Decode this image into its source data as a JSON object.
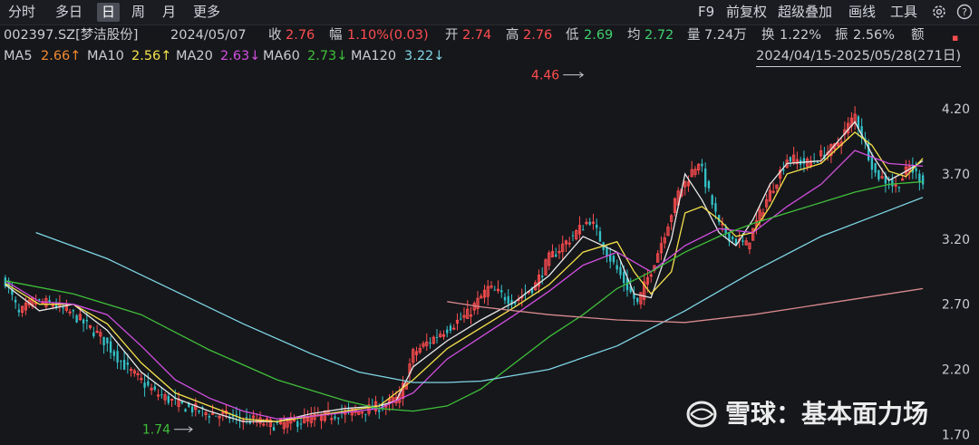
{
  "toolbar": {
    "tabs": [
      "分时",
      "多日",
      "日",
      "周",
      "月",
      "更多"
    ],
    "active_tab": "日",
    "right": [
      "F9",
      "前复权",
      "超级叠加",
      "画线",
      "工具"
    ],
    "icons": [
      "settings-icon",
      "help-icon"
    ]
  },
  "info": {
    "code": "002397.SZ[梦洁股份]",
    "date": "2024/05/07",
    "close_label": "收",
    "close": "2.76",
    "change_label": "幅",
    "change": "1.10%(0.03)",
    "open_label": "开",
    "open": "2.74",
    "high_label": "高",
    "high": "2.76",
    "low_label": "低",
    "low": "2.69",
    "avg_label": "均",
    "avg": "2.72",
    "vol_label": "量",
    "vol": "7.24万",
    "turnover_label": "换",
    "turnover": "1.22%",
    "amp_label": "振",
    "amp": "2.56%",
    "amount_label": "额"
  },
  "ma": {
    "ma5_label": "MA5",
    "ma5": "2.66↑",
    "ma10_label": "MA10",
    "ma10": "2.56↑",
    "ma20_label": "MA20",
    "ma20": "2.63↓",
    "ma60_label": "MA60",
    "ma60": "2.73↓",
    "ma120_label": "MA120",
    "ma120": "3.22↓",
    "range": "2024/04/15-2025/05/28(271日)"
  },
  "colors": {
    "up": "#ff4d4f",
    "down": "#33c3c9",
    "ma5": "#e8e8e8",
    "ma10": "#f5e14b",
    "ma20": "#d14fe0",
    "ma60": "#3fbf3a",
    "ma120": "#7fd6e6",
    "ma250": "#d88a8e"
  },
  "watermark": "雪球：基本面力场",
  "chart_data": {
    "type": "candlestick",
    "ylim": [
      1.62,
      4.52
    ],
    "yticks": [
      4.2,
      3.7,
      3.2,
      2.7,
      2.2,
      1.7
    ],
    "ytick_labels": [
      "4.20",
      "3.70",
      "3.20",
      "2.70",
      "2.20",
      "1.70"
    ],
    "annotations": [
      {
        "label": "4.46"
      },
      {
        "label": "1.74"
      }
    ],
    "price_path_x": [
      0,
      4,
      8,
      14,
      20,
      28,
      36,
      44,
      52,
      60,
      70,
      80,
      90,
      98,
      104,
      108,
      112,
      116,
      120,
      128,
      136,
      142,
      150,
      156,
      160,
      166,
      172,
      178,
      186,
      192,
      198,
      204,
      210,
      214,
      218,
      224,
      230,
      236,
      244,
      250,
      256,
      262,
      266,
      270
    ],
    "price_path_y": [
      2.88,
      2.62,
      2.72,
      2.7,
      2.62,
      2.45,
      2.2,
      2.02,
      1.92,
      1.86,
      1.82,
      1.77,
      1.82,
      1.86,
      1.88,
      1.9,
      1.93,
      1.98,
      2.32,
      2.48,
      2.62,
      2.82,
      2.72,
      2.85,
      3.05,
      3.2,
      3.35,
      3.05,
      2.7,
      3.1,
      3.55,
      3.8,
      3.3,
      3.2,
      3.15,
      3.5,
      3.82,
      3.78,
      3.9,
      4.15,
      3.7,
      3.6,
      3.75,
      3.65
    ],
    "ma_series": [
      {
        "name": "MA5",
        "x": [
          0,
          10,
          20,
          30,
          40,
          50,
          60,
          70,
          80,
          90,
          100,
          110,
          115,
          120,
          130,
          140,
          150,
          160,
          170,
          180,
          185,
          190,
          196,
          200,
          205,
          210,
          215,
          220,
          225,
          230,
          240,
          250,
          255,
          260,
          265,
          270
        ],
        "y": [
          2.85,
          2.65,
          2.7,
          2.5,
          2.18,
          1.98,
          1.88,
          1.8,
          1.8,
          1.86,
          1.9,
          1.92,
          1.96,
          2.22,
          2.42,
          2.58,
          2.72,
          2.92,
          3.22,
          3.1,
          2.78,
          2.75,
          3.2,
          3.7,
          3.5,
          3.25,
          3.15,
          3.35,
          3.62,
          3.78,
          3.8,
          4.1,
          3.85,
          3.65,
          3.72,
          3.8
        ]
      },
      {
        "name": "MA10",
        "x": [
          0,
          10,
          20,
          30,
          40,
          50,
          60,
          70,
          80,
          90,
          100,
          110,
          120,
          130,
          140,
          150,
          160,
          170,
          180,
          185,
          190,
          196,
          200,
          205,
          210,
          215,
          220,
          225,
          230,
          240,
          250,
          255,
          260,
          265,
          270
        ],
        "y": [
          2.86,
          2.7,
          2.7,
          2.55,
          2.25,
          2.02,
          1.92,
          1.82,
          1.8,
          1.84,
          1.88,
          1.92,
          2.12,
          2.36,
          2.52,
          2.68,
          2.85,
          3.1,
          3.18,
          2.95,
          2.78,
          2.95,
          3.4,
          3.45,
          3.35,
          3.22,
          3.25,
          3.45,
          3.7,
          3.78,
          4.02,
          3.92,
          3.72,
          3.68,
          3.82
        ]
      },
      {
        "name": "MA20",
        "x": [
          0,
          10,
          20,
          30,
          40,
          50,
          60,
          70,
          80,
          90,
          100,
          110,
          120,
          130,
          140,
          150,
          160,
          170,
          180,
          190,
          200,
          210,
          220,
          230,
          240,
          250,
          260,
          270
        ],
        "y": [
          2.88,
          2.72,
          2.7,
          2.62,
          2.38,
          2.12,
          1.98,
          1.88,
          1.82,
          1.84,
          1.87,
          1.9,
          2.02,
          2.28,
          2.45,
          2.62,
          2.8,
          3.0,
          3.1,
          2.95,
          3.15,
          3.28,
          3.25,
          3.45,
          3.62,
          3.88,
          3.78,
          3.76
        ]
      },
      {
        "name": "MA60",
        "x": [
          0,
          20,
          40,
          60,
          80,
          100,
          110,
          120,
          130,
          140,
          150,
          160,
          170,
          180,
          190,
          200,
          210,
          220,
          230,
          240,
          250,
          260,
          270
        ],
        "y": [
          2.88,
          2.78,
          2.62,
          2.35,
          2.12,
          1.96,
          1.9,
          1.88,
          1.92,
          2.05,
          2.25,
          2.45,
          2.62,
          2.82,
          2.95,
          3.1,
          3.22,
          3.32,
          3.4,
          3.48,
          3.56,
          3.62,
          3.64
        ]
      },
      {
        "name": "MA120",
        "x": [
          9,
          30,
          50,
          70,
          90,
          104,
          120,
          130,
          140,
          160,
          180,
          200,
          220,
          240,
          260,
          270
        ],
        "y": [
          3.25,
          3.05,
          2.8,
          2.55,
          2.32,
          2.18,
          2.1,
          2.1,
          2.11,
          2.2,
          2.38,
          2.65,
          2.95,
          3.22,
          3.42,
          3.52
        ]
      },
      {
        "name": "MA250",
        "x": [
          130,
          140,
          160,
          180,
          200,
          220,
          240,
          260,
          270
        ],
        "y": [
          2.72,
          2.68,
          2.62,
          2.58,
          2.56,
          2.62,
          2.7,
          2.78,
          2.82
        ]
      }
    ]
  }
}
